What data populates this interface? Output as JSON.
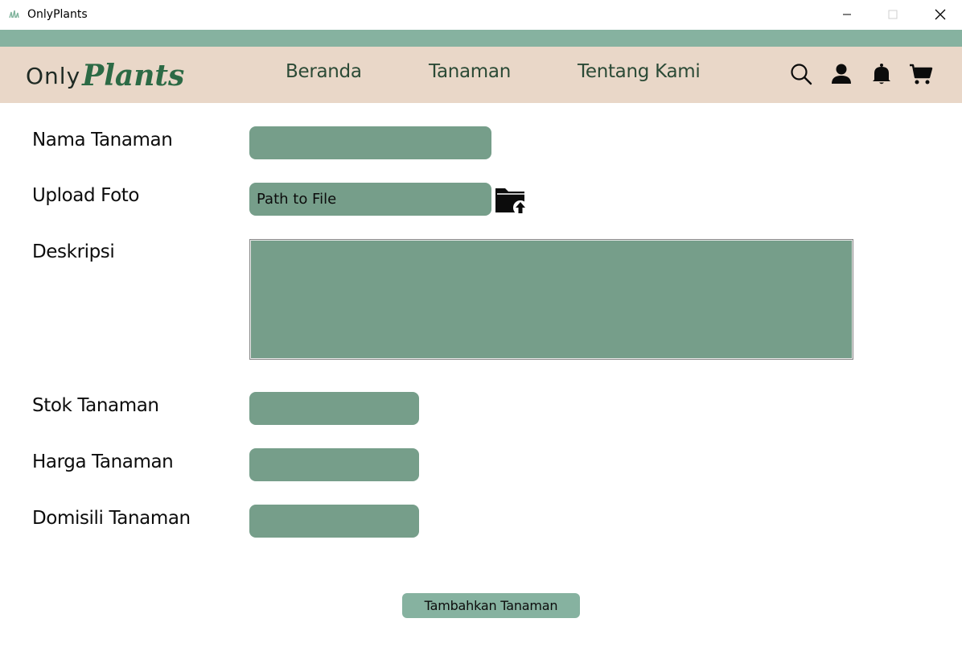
{
  "window": {
    "title": "OnlyPlants",
    "icon": "plant-app-icon",
    "controls": {
      "minimize": "minimize-icon",
      "maximize": "maximize-icon",
      "close": "close-icon"
    }
  },
  "header": {
    "logo_only": "Only",
    "logo_plants": "Plants",
    "nav": [
      "Beranda",
      "Tanaman",
      "Tentang Kami"
    ],
    "icons": [
      "search-icon",
      "user-icon",
      "bell-icon",
      "cart-icon"
    ]
  },
  "form": {
    "nama_label": "Nama Tanaman",
    "nama_value": "",
    "foto_label": "Upload Foto",
    "foto_value": "Path to File",
    "foto_icon": "folder-upload-icon",
    "deskripsi_label": "Deskripsi",
    "deskripsi_value": "",
    "stok_label": "Stok Tanaman",
    "stok_value": "",
    "harga_label": "Harga Tanaman",
    "harga_value": "",
    "domisili_label": "Domisili Tanaman",
    "domisili_value": "",
    "submit_label": "Tambahkan Tanaman"
  },
  "colors": {
    "header_bg": "#e9d7c8",
    "strip": "#86b2a0",
    "field_bg": "#769e8a",
    "nav_text": "#2b4a36",
    "logo_green": "#2c6a45"
  }
}
